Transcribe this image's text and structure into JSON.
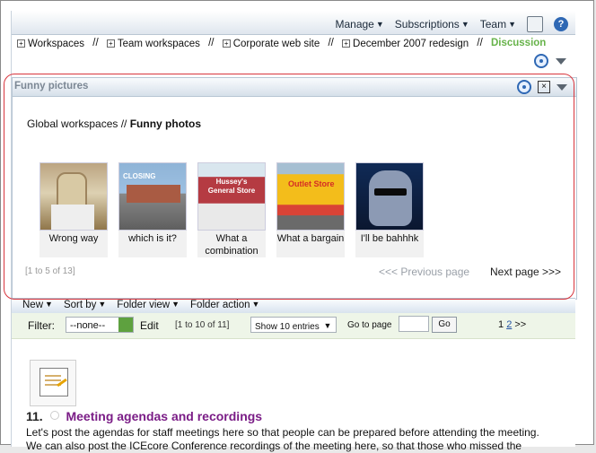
{
  "topbar": {
    "menu": [
      "Manage",
      "Subscriptions",
      "Team"
    ]
  },
  "breadcrumb": {
    "items": [
      "Workspaces",
      "Team workspaces",
      "Corporate web site",
      "December 2007 redesign"
    ],
    "current": "Discussion",
    "separator": "//"
  },
  "portlet": {
    "title": "Funny pictures",
    "path_prefix": "Global workspaces // ",
    "path_current": "Funny photos",
    "cards": [
      {
        "caption": "Wrong way",
        "icon": "photo-icon"
      },
      {
        "caption": "which is it?",
        "icon": "photo-icon"
      },
      {
        "caption": "What a combination",
        "icon": "photo-icon"
      },
      {
        "caption": "What a bargain",
        "icon": "photo-icon"
      },
      {
        "caption": "I'll be bahhhk",
        "icon": "photo-icon"
      }
    ],
    "count": "[1 to 5 of 13]",
    "prev": "<<< Previous page",
    "next": "Next page >>>"
  },
  "folderbar": {
    "menu": [
      "New",
      "Sort by",
      "Folder view",
      "Folder action"
    ]
  },
  "filter": {
    "label": "Filter:",
    "selected": "--none--",
    "edit": "Edit",
    "range": "[1 to 10 of 11]",
    "entries": "Show 10 entries",
    "goto_label": "Go to page",
    "go": "Go",
    "pages": [
      "1",
      "2",
      ">>"
    ]
  },
  "item": {
    "number": "11.",
    "title": "Meeting agendas and recordings",
    "description": "Let's post the agendas for staff meetings here so that people can be prepared before attending the meeting. We can also post the ICEcore Conference recordings of the meeting here, so that those who missed the"
  },
  "colors": {
    "accent": "#2f68b4",
    "current": "#67b34a",
    "link": "#7a1c86",
    "selection": "#d8353d"
  }
}
